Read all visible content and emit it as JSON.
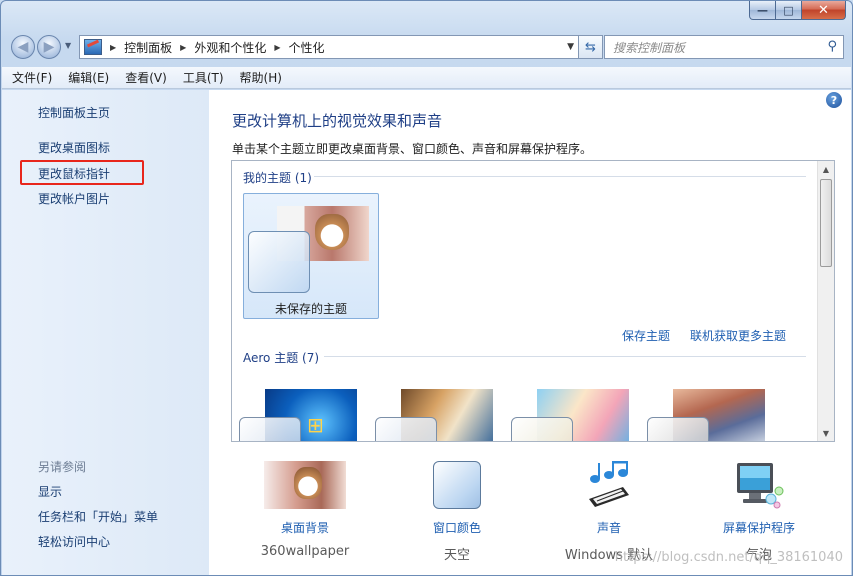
{
  "window": {
    "caption": {
      "min_glyph": "—",
      "max_glyph": "□",
      "close_glyph": "✕"
    }
  },
  "address": {
    "crumbs": [
      "控制面板",
      "外观和个性化",
      "个性化"
    ]
  },
  "search": {
    "placeholder": "搜索控制面板"
  },
  "menu": [
    "文件(F)",
    "编辑(E)",
    "查看(V)",
    "工具(T)",
    "帮助(H)"
  ],
  "left_pane": {
    "home": "控制面板主页",
    "links": [
      "更改桌面图标",
      "更改鼠标指针",
      "更改帐户图片"
    ],
    "see_also_heading": "另请参阅",
    "see_also": [
      "显示",
      "任务栏和「开始」菜单",
      "轻松访问中心"
    ]
  },
  "main": {
    "title": "更改计算机上的视觉效果和声音",
    "subtitle": "单击某个主题立即更改桌面背景、窗口颜色、声音和屏幕保护程序。",
    "my_themes_heading": "我的主题 (1)",
    "unsaved_theme": "未保存的主题",
    "save_theme": "保存主题",
    "get_more_themes": "联机获取更多主题",
    "aero_heading": "Aero 主题 (7)"
  },
  "bottom": [
    {
      "label": "桌面背景",
      "value": "360wallpaper",
      "icon": "cat-photo-icon"
    },
    {
      "label": "窗口颜色",
      "value": "天空",
      "icon": "window-color-icon"
    },
    {
      "label": "声音",
      "value": "Windows 默认",
      "icon": "music-notes-icon"
    },
    {
      "label": "屏幕保护程序",
      "value": "气泡",
      "icon": "monitor-bubbles-icon"
    }
  ],
  "watermark": "https://blog.csdn.net/qq_38161040",
  "colors": {
    "link": "#1f5fb1",
    "title": "#1f3f86",
    "highlight": "#e8261c"
  }
}
